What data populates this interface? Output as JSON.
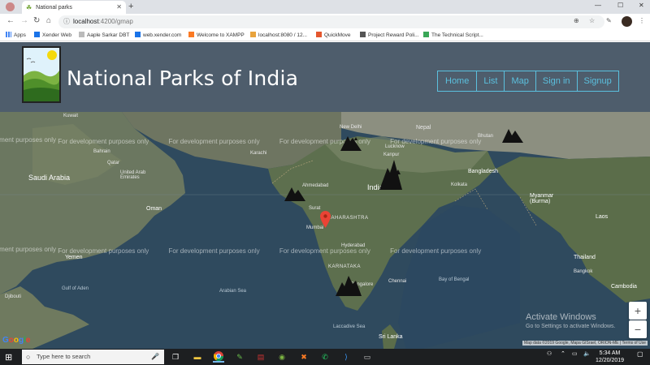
{
  "browser": {
    "tab_title": "National parks",
    "url_host": "localhost",
    "url_path": ":4200/gmap",
    "bookmarks": [
      "Apps",
      "Xender Web",
      "Aaple Sarkar DBT",
      "web.xender.com",
      "Welcome to XAMPP",
      "localhost:8080 / 12...",
      "QuickMove",
      "Project Reward Poli...",
      "The Technical Script..."
    ]
  },
  "header": {
    "title": "National Parks of India",
    "nav": [
      "Home",
      "List",
      "Map",
      "Sign in",
      "Signup"
    ]
  },
  "map": {
    "watermark": "For development purposes only",
    "labels": {
      "kuwait": "Kuwait",
      "bahrain": "Bahrain",
      "qatar": "Qatar",
      "uae": "United Arab Emirates",
      "saudi": "Saudi Arabia",
      "oman": "Oman",
      "yemen": "Yemen",
      "djibouti": "Djibouti",
      "karachi": "Karachi",
      "new_delhi": "New Delhi",
      "lucknow": "Lucknow",
      "kanpur": "Kanpur",
      "nepal": "Nepal",
      "bhutan": "Bhutan",
      "bangladesh": "Bangladesh",
      "kolkata": "Kolkata",
      "ahmedabad": "Ahmedabad",
      "surat": "Surat",
      "mumbai": "Mumbai",
      "hyderabad": "Hyderabad",
      "chennai": "Chennai",
      "bangalore": "Bangalore",
      "sri_lanka": "Sri Lanka",
      "myanmar": "Myanmar (Burma)",
      "laos": "Laos",
      "thailand": "Thailand",
      "bangkok": "Bangkok",
      "cambodia": "Cambodia",
      "maharashtra": "MAHARASHTRA",
      "karnataka": "KARNATAKA",
      "arabian_sea": "Arabian Sea",
      "bay_of_bengal": "Bay of Bengal",
      "gulf_of_aden": "Gulf of Aden",
      "laccadive": "Laccadive Sea",
      "india": "India"
    },
    "attribution": "Map data ©2019 Google, Mapa GISrael, ORION-ME | Terms of Use",
    "google_logo": "Google",
    "zoom_in": "+",
    "zoom_out": "−",
    "activate_title": "Activate Windows",
    "activate_sub": "Go to Settings to activate Windows."
  },
  "taskbar": {
    "search_placeholder": "Type here to search",
    "time": "5:34 AM",
    "date": "12/20/2019"
  }
}
